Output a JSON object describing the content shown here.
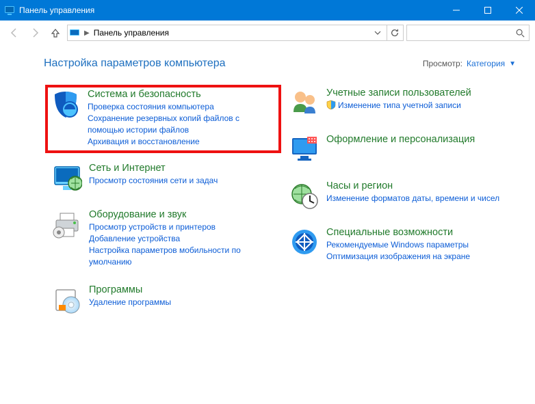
{
  "window": {
    "title": "Панель управления"
  },
  "address": {
    "crumb": "Панель управления"
  },
  "heading": "Настройка параметров компьютера",
  "viewby": {
    "label": "Просмотр:",
    "value": "Категория"
  },
  "left": [
    {
      "id": "system-security",
      "highlight": true,
      "icon": "shield",
      "title": "Система и безопасность",
      "links": [
        {
          "id": "check-status",
          "text": "Проверка состояния компьютера"
        },
        {
          "id": "file-history-backup",
          "text": "Сохранение резервных копий файлов с помощью истории файлов"
        },
        {
          "id": "backup-restore",
          "text": "Архивация и восстановление"
        }
      ]
    },
    {
      "id": "network-internet",
      "icon": "globe",
      "title": "Сеть и Интернет",
      "links": [
        {
          "id": "network-status",
          "text": "Просмотр состояния сети и задач"
        }
      ]
    },
    {
      "id": "hardware-sound",
      "icon": "printer",
      "title": "Оборудование и звук",
      "links": [
        {
          "id": "devices-printers",
          "text": "Просмотр устройств и принтеров"
        },
        {
          "id": "add-device",
          "text": "Добавление устройства"
        },
        {
          "id": "mobility-defaults",
          "text": "Настройка параметров мобильности по умолчанию"
        }
      ]
    },
    {
      "id": "programs",
      "icon": "disc",
      "title": "Программы",
      "links": [
        {
          "id": "uninstall",
          "text": "Удаление программы"
        }
      ]
    }
  ],
  "right": [
    {
      "id": "user-accounts",
      "icon": "people",
      "title": "Учетные записи пользователей",
      "links": [
        {
          "id": "change-account-type",
          "text": "Изменение типа учетной записи",
          "uac": true
        }
      ]
    },
    {
      "id": "appearance-personalization",
      "icon": "monitor",
      "title": "Оформление и персонализация",
      "links": []
    },
    {
      "id": "clock-region",
      "icon": "globe-clock",
      "title": "Часы и регион",
      "links": [
        {
          "id": "date-time-format",
          "text": "Изменение форматов даты, времени и чисел"
        }
      ]
    },
    {
      "id": "ease-of-access",
      "icon": "ease",
      "title": "Специальные возможности",
      "links": [
        {
          "id": "recommended-settings",
          "text": "Рекомендуемые Windows параметры"
        },
        {
          "id": "optimize-display",
          "text": "Оптимизация изображения на экране"
        }
      ]
    }
  ]
}
